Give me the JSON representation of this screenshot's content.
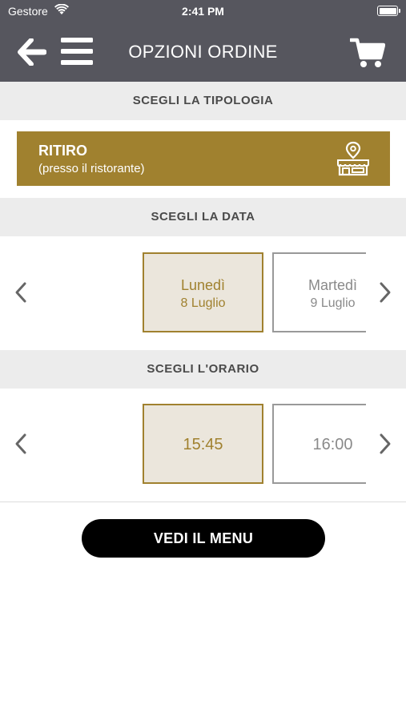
{
  "status_bar": {
    "carrier": "Gestore",
    "time": "2:41 PM",
    "battery_level": 1.0
  },
  "header": {
    "title": "OPZIONI ORDINE",
    "back_icon": "arrow-left-icon",
    "menu_icon": "hamburger-menu-icon",
    "cart_icon": "shopping-cart-icon"
  },
  "sections": {
    "type_header": "SCEGLI LA TIPOLOGIA",
    "date_header": "SCEGLI LA DATA",
    "time_header": "SCEGLI L'ORARIO"
  },
  "type_option": {
    "title": "RITIRO",
    "subtitle": "(presso il ristorante)",
    "icon": "store-location-icon",
    "color": "#a0812f"
  },
  "dates": [
    {
      "day": "Lunedì",
      "date": "8 Luglio",
      "selected": true
    },
    {
      "day": "Martedì",
      "date": "9 Luglio",
      "selected": false
    }
  ],
  "times": [
    {
      "time": "15:45",
      "selected": true
    },
    {
      "time": "16:00",
      "selected": false
    }
  ],
  "menu_button": {
    "label": "VEDI IL MENU"
  },
  "colors": {
    "nav_background": "#56565e",
    "accent": "#a0812f",
    "selected_background": "#ebe6dc",
    "section_background": "#ececec"
  }
}
